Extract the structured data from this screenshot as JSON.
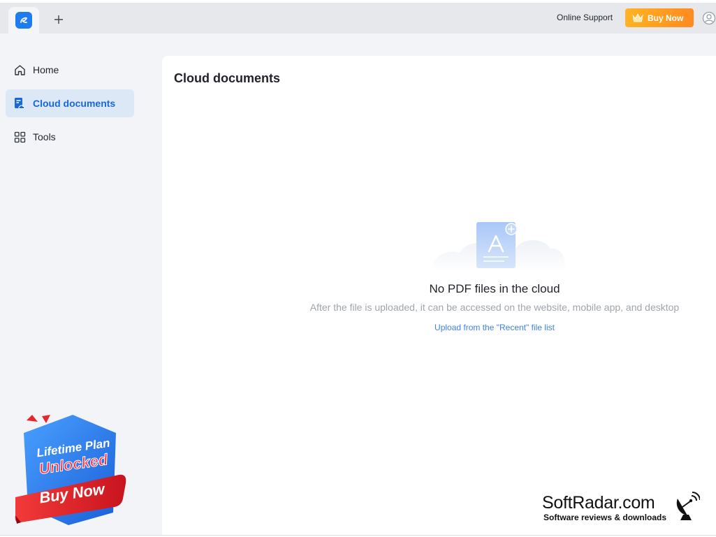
{
  "titlebar": {
    "online_support": "Online Support",
    "buy_now": "Buy Now",
    "icons": [
      "app-logo-icon",
      "plus-icon",
      "crown-icon",
      "user-avatar-icon"
    ]
  },
  "sidebar": {
    "items": [
      {
        "label": "Home",
        "icon": "home-icon"
      },
      {
        "label": "Cloud documents",
        "icon": "cloud-document-icon",
        "active": true
      },
      {
        "label": "Tools",
        "icon": "grid-icon"
      }
    ],
    "promo": {
      "line1": "Lifetime Plan",
      "line2": "Unlocked",
      "line3": "Buy Now"
    }
  },
  "main": {
    "title": "Cloud documents",
    "empty": {
      "title": "No PDF files in the cloud",
      "subtitle": "After the file is uploaded, it can be accessed on the website, mobile app, and desktop",
      "link": "Upload from the \"Recent\" file list"
    }
  },
  "watermark": {
    "title": "SoftRadar.com",
    "subtitle": "Software reviews & downloads"
  },
  "colors": {
    "accent": "#1668dc",
    "active_bg": "#dde8f7",
    "buy_orange": "#ff8a1f",
    "link": "#3b82e8",
    "promo_blue": "#2f7cf0",
    "promo_red": "#e8252f"
  }
}
